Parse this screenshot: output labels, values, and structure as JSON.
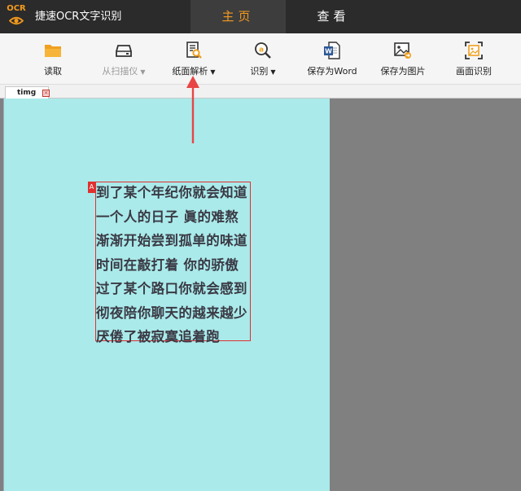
{
  "app": {
    "logo_text": "OCR",
    "title": "捷速OCR文字识别"
  },
  "tabs": [
    {
      "label": "主页",
      "active": true
    },
    {
      "label": "查看",
      "active": false
    }
  ],
  "toolbar": {
    "items": [
      {
        "label": "读取",
        "icon": "folder-icon"
      },
      {
        "label": "从扫描仪",
        "icon": "scanner-icon",
        "disabled": true,
        "has_dropdown": true
      },
      {
        "label": "纸面解析",
        "icon": "page-analyze-icon",
        "has_dropdown": true
      },
      {
        "label": "识别",
        "icon": "recognize-icon",
        "has_dropdown": true
      },
      {
        "label": "保存为Word",
        "icon": "word-icon"
      },
      {
        "label": "保存为图片",
        "icon": "save-image-icon"
      },
      {
        "label": "画面识别",
        "icon": "screen-recognize-icon"
      }
    ],
    "dropdown_glyph": "▼"
  },
  "document_tab": {
    "name": "timg",
    "close_glyph": "×"
  },
  "region": {
    "tag": "A"
  },
  "ocr_text": [
    "到了某个年纪你就会知道",
    "一个人的日子 眞的难熬",
    "渐渐开始尝到孤单的味道",
    "时间在敲打着 你的骄傲",
    "过了某个路口你就会感到",
    "彻夜陪你聊天的越来越少",
    "厌倦了被寂寞追着跑"
  ],
  "colors": {
    "accent": "#f39a1e",
    "titlebar": "#2b2b2b",
    "page_bg": "#aaeaea",
    "canvas_bg": "#808080",
    "region_border": "#e03030",
    "pointer_arrow": "#e84545"
  }
}
